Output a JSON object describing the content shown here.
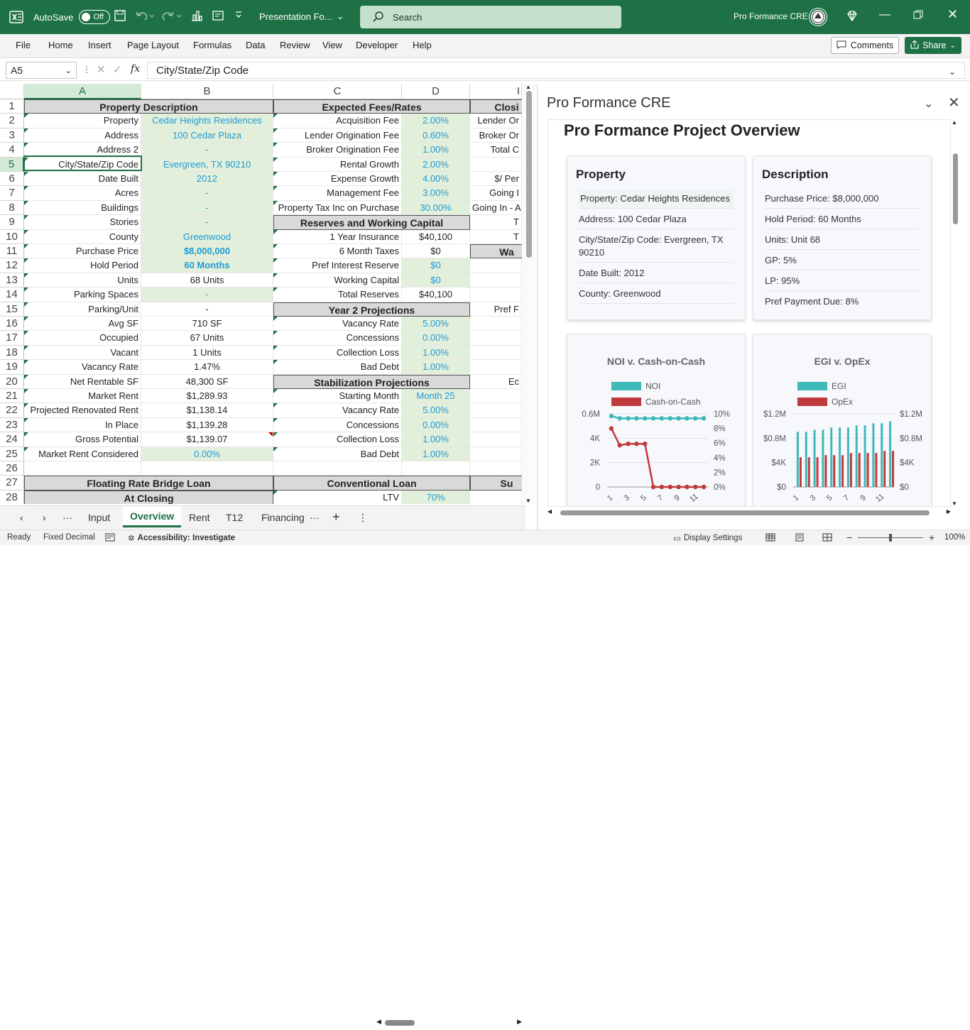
{
  "titlebar": {
    "autosave": "AutoSave",
    "toggle": "Off",
    "doc_title": "Presentation Fo...",
    "search": "Search",
    "account": "Pro Formance CRE"
  },
  "ribbon": {
    "tabs": [
      "File",
      "Home",
      "Insert",
      "Page Layout",
      "Formulas",
      "Data",
      "Review",
      "View",
      "Developer",
      "Help"
    ],
    "comments": "Comments",
    "share": "Share"
  },
  "formula_bar": {
    "name_box": "A5",
    "fx": "fx",
    "value": "City/State/Zip Code"
  },
  "columns": [
    "A",
    "B",
    "C",
    "D",
    "I"
  ],
  "rows": [
    "1",
    "2",
    "3",
    "4",
    "5",
    "6",
    "7",
    "8",
    "9",
    "10",
    "11",
    "12",
    "13",
    "14",
    "15",
    "16",
    "17",
    "18",
    "19",
    "20",
    "21",
    "22",
    "23",
    "24",
    "25",
    "26",
    "27",
    "28"
  ],
  "sheet": {
    "col_a": [
      "Property Description",
      "Property",
      "Address",
      "Address 2",
      "City/State/Zip Code",
      "Date Built",
      "Acres",
      "Buildings",
      "Stories",
      "County",
      "Purchase Price",
      "Hold Period",
      "Units",
      "Parking Spaces",
      "Parking/Unit",
      "Avg SF",
      "Occupied",
      "Vacant",
      "Vacancy Rate",
      "Net Rentable SF",
      "Market Rent",
      "Projected Renovated Rent",
      "In Place",
      "Gross Potential",
      "Market Rent Considered",
      "",
      "Floating Rate Bridge Loan",
      "At Closing"
    ],
    "col_b": [
      "",
      "Cedar Heights Residences",
      "100 Cedar Plaza",
      "-",
      "Evergreen, TX 90210",
      "2012",
      "-",
      "-",
      "-",
      "Greenwood",
      "$8,000,000",
      "60 Months",
      "68 Units",
      "-",
      "-",
      "710 SF",
      "67 Units",
      "1 Units",
      "1.47%",
      "48,300 SF",
      "$1,289.93",
      "$1,138.14",
      "$1,139.28",
      "$1,139.07",
      "0.00%",
      "",
      "",
      ""
    ],
    "col_c": [
      "Expected Fees/Rates",
      "Acquisition Fee",
      "Lender Origination Fee",
      "Broker Origination Fee",
      "Rental Growth",
      "Expense Growth",
      "Management Fee",
      "Property Tax Inc on Purchase",
      "Reserves and Working Capital",
      "1 Year Insurance",
      "6 Month Taxes",
      "Pref Interest Reserve",
      "Working Capital",
      "Total Reserves",
      "Year 2 Projections",
      "Vacancy Rate",
      "Concessions",
      "Collection Loss",
      "Bad Debt",
      "Stabilization Projections",
      "Starting Month",
      "Vacancy Rate",
      "Concessions",
      "Collection Loss",
      "Bad Debt",
      "",
      "Conventional Loan",
      "LTV"
    ],
    "col_d": [
      "",
      "2.00%",
      "0.60%",
      "1.00%",
      "2.00%",
      "4.00%",
      "3.00%",
      "30.00%",
      "",
      "$40,100",
      "$0",
      "$0",
      "$0",
      "$40,100",
      "",
      "5.00%",
      "0.00%",
      "1.00%",
      "1.00%",
      "",
      "Month 25",
      "5.00%",
      "0.00%",
      "1.00%",
      "1.00%",
      "",
      "",
      "70%"
    ],
    "col_e": [
      "Closi",
      "Lender Or",
      "Broker Or",
      "Total C",
      "",
      "$/ Per",
      "Going I",
      "Going In - A",
      "T",
      "T",
      "Wa",
      "",
      "",
      "",
      "Pref F",
      "",
      "",
      "",
      "",
      "Ec",
      "",
      "",
      "",
      "",
      "",
      "",
      "Su",
      ""
    ]
  },
  "sheet_tabs": {
    "items": [
      "Input",
      "Overview",
      "Rent",
      "T12",
      "Financing"
    ],
    "active": "Overview"
  },
  "status": {
    "ready": "Ready",
    "fixed": "Fixed Decimal",
    "accessibility": "Accessibility: Investigate",
    "display": "Display Settings",
    "zoom": "100%"
  },
  "pane": {
    "title": "Pro Formance CRE",
    "overview_title": "Pro Formance Project Overview",
    "property": {
      "heading": "Property",
      "items": [
        "Property: Cedar Heights Residences",
        "Address: 100 Cedar Plaza",
        "City/State/Zip Code: Evergreen, TX 90210",
        "Date Built: 2012",
        "County: Greenwood"
      ]
    },
    "description": {
      "heading": "Description",
      "items": [
        "Purchase Price: $8,000,000",
        "Hold Period: 60 Months",
        "Units: Unit 68",
        "GP: 5%",
        "LP: 95%",
        "Pref Payment Due: 8%"
      ]
    }
  },
  "chart_data": [
    {
      "type": "line",
      "title": "NOI v. Cash-on-Cash",
      "legend": [
        "NOI",
        "Cash-on-Cash"
      ],
      "colors": [
        "#3fb8b8",
        "#c0393b"
      ],
      "x": [
        1,
        2,
        3,
        4,
        5,
        6,
        7,
        8,
        9,
        10,
        11,
        12
      ],
      "x_ticks": [
        "1",
        "3",
        "5",
        "7",
        "9",
        "11"
      ],
      "y_left_ticks": [
        "0",
        "2K",
        "4K",
        "0.6M"
      ],
      "y_right_ticks": [
        "0%",
        "2%",
        "4%",
        "6%",
        "8%",
        "10%"
      ],
      "series": [
        {
          "name": "NOI",
          "axis": "left",
          "values": [
            0.62,
            0.6,
            0.6,
            0.6,
            0.6,
            0.6,
            0.6,
            0.6,
            0.6,
            0.6,
            0.6,
            0.6
          ]
        },
        {
          "name": "Cash-on-Cash",
          "axis": "right",
          "values": [
            8.0,
            5.7,
            5.9,
            5.9,
            5.9,
            0,
            0,
            0,
            0,
            0,
            0,
            0
          ]
        }
      ]
    },
    {
      "type": "bar",
      "title": "EGI v. OpEx",
      "legend": [
        "EGI",
        "OpEx"
      ],
      "colors": [
        "#3fb8b8",
        "#c0393b"
      ],
      "x": [
        1,
        2,
        3,
        4,
        5,
        6,
        7,
        8,
        9,
        10,
        11,
        12
      ],
      "x_ticks": [
        "1",
        "3",
        "5",
        "7",
        "9",
        "11"
      ],
      "y_left_ticks": [
        "$0",
        "$4K",
        "$0.8M",
        "$1.2M"
      ],
      "y_right_ticks": [
        "$0",
        "$4K",
        "$0.8M",
        "$1.2M"
      ],
      "series": [
        {
          "name": "EGI",
          "values": [
            0.26,
            0.26,
            0.27,
            0.27,
            0.28,
            0.28,
            0.28,
            0.29,
            0.29,
            0.3,
            0.3,
            0.31
          ]
        },
        {
          "name": "OpEx",
          "values": [
            0.14,
            0.14,
            0.14,
            0.15,
            0.15,
            0.15,
            0.16,
            0.16,
            0.16,
            0.16,
            0.17,
            0.17
          ]
        }
      ]
    }
  ]
}
